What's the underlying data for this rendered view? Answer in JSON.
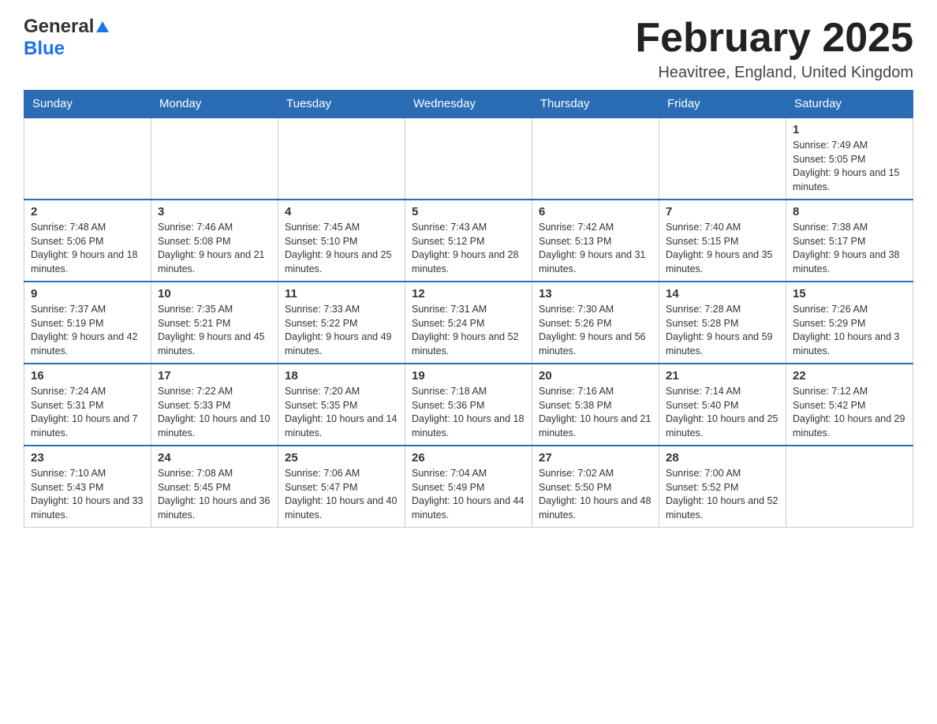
{
  "header": {
    "logo_general": "General",
    "logo_blue": "Blue",
    "month_title": "February 2025",
    "location": "Heavitree, England, United Kingdom"
  },
  "days_of_week": [
    "Sunday",
    "Monday",
    "Tuesday",
    "Wednesday",
    "Thursday",
    "Friday",
    "Saturday"
  ],
  "weeks": [
    {
      "days": [
        {
          "number": "",
          "info": ""
        },
        {
          "number": "",
          "info": ""
        },
        {
          "number": "",
          "info": ""
        },
        {
          "number": "",
          "info": ""
        },
        {
          "number": "",
          "info": ""
        },
        {
          "number": "",
          "info": ""
        },
        {
          "number": "1",
          "info": "Sunrise: 7:49 AM\nSunset: 5:05 PM\nDaylight: 9 hours and 15 minutes."
        }
      ]
    },
    {
      "days": [
        {
          "number": "2",
          "info": "Sunrise: 7:48 AM\nSunset: 5:06 PM\nDaylight: 9 hours and 18 minutes."
        },
        {
          "number": "3",
          "info": "Sunrise: 7:46 AM\nSunset: 5:08 PM\nDaylight: 9 hours and 21 minutes."
        },
        {
          "number": "4",
          "info": "Sunrise: 7:45 AM\nSunset: 5:10 PM\nDaylight: 9 hours and 25 minutes."
        },
        {
          "number": "5",
          "info": "Sunrise: 7:43 AM\nSunset: 5:12 PM\nDaylight: 9 hours and 28 minutes."
        },
        {
          "number": "6",
          "info": "Sunrise: 7:42 AM\nSunset: 5:13 PM\nDaylight: 9 hours and 31 minutes."
        },
        {
          "number": "7",
          "info": "Sunrise: 7:40 AM\nSunset: 5:15 PM\nDaylight: 9 hours and 35 minutes."
        },
        {
          "number": "8",
          "info": "Sunrise: 7:38 AM\nSunset: 5:17 PM\nDaylight: 9 hours and 38 minutes."
        }
      ]
    },
    {
      "days": [
        {
          "number": "9",
          "info": "Sunrise: 7:37 AM\nSunset: 5:19 PM\nDaylight: 9 hours and 42 minutes."
        },
        {
          "number": "10",
          "info": "Sunrise: 7:35 AM\nSunset: 5:21 PM\nDaylight: 9 hours and 45 minutes."
        },
        {
          "number": "11",
          "info": "Sunrise: 7:33 AM\nSunset: 5:22 PM\nDaylight: 9 hours and 49 minutes."
        },
        {
          "number": "12",
          "info": "Sunrise: 7:31 AM\nSunset: 5:24 PM\nDaylight: 9 hours and 52 minutes."
        },
        {
          "number": "13",
          "info": "Sunrise: 7:30 AM\nSunset: 5:26 PM\nDaylight: 9 hours and 56 minutes."
        },
        {
          "number": "14",
          "info": "Sunrise: 7:28 AM\nSunset: 5:28 PM\nDaylight: 9 hours and 59 minutes."
        },
        {
          "number": "15",
          "info": "Sunrise: 7:26 AM\nSunset: 5:29 PM\nDaylight: 10 hours and 3 minutes."
        }
      ]
    },
    {
      "days": [
        {
          "number": "16",
          "info": "Sunrise: 7:24 AM\nSunset: 5:31 PM\nDaylight: 10 hours and 7 minutes."
        },
        {
          "number": "17",
          "info": "Sunrise: 7:22 AM\nSunset: 5:33 PM\nDaylight: 10 hours and 10 minutes."
        },
        {
          "number": "18",
          "info": "Sunrise: 7:20 AM\nSunset: 5:35 PM\nDaylight: 10 hours and 14 minutes."
        },
        {
          "number": "19",
          "info": "Sunrise: 7:18 AM\nSunset: 5:36 PM\nDaylight: 10 hours and 18 minutes."
        },
        {
          "number": "20",
          "info": "Sunrise: 7:16 AM\nSunset: 5:38 PM\nDaylight: 10 hours and 21 minutes."
        },
        {
          "number": "21",
          "info": "Sunrise: 7:14 AM\nSunset: 5:40 PM\nDaylight: 10 hours and 25 minutes."
        },
        {
          "number": "22",
          "info": "Sunrise: 7:12 AM\nSunset: 5:42 PM\nDaylight: 10 hours and 29 minutes."
        }
      ]
    },
    {
      "days": [
        {
          "number": "23",
          "info": "Sunrise: 7:10 AM\nSunset: 5:43 PM\nDaylight: 10 hours and 33 minutes."
        },
        {
          "number": "24",
          "info": "Sunrise: 7:08 AM\nSunset: 5:45 PM\nDaylight: 10 hours and 36 minutes."
        },
        {
          "number": "25",
          "info": "Sunrise: 7:06 AM\nSunset: 5:47 PM\nDaylight: 10 hours and 40 minutes."
        },
        {
          "number": "26",
          "info": "Sunrise: 7:04 AM\nSunset: 5:49 PM\nDaylight: 10 hours and 44 minutes."
        },
        {
          "number": "27",
          "info": "Sunrise: 7:02 AM\nSunset: 5:50 PM\nDaylight: 10 hours and 48 minutes."
        },
        {
          "number": "28",
          "info": "Sunrise: 7:00 AM\nSunset: 5:52 PM\nDaylight: 10 hours and 52 minutes."
        },
        {
          "number": "",
          "info": ""
        }
      ]
    }
  ]
}
